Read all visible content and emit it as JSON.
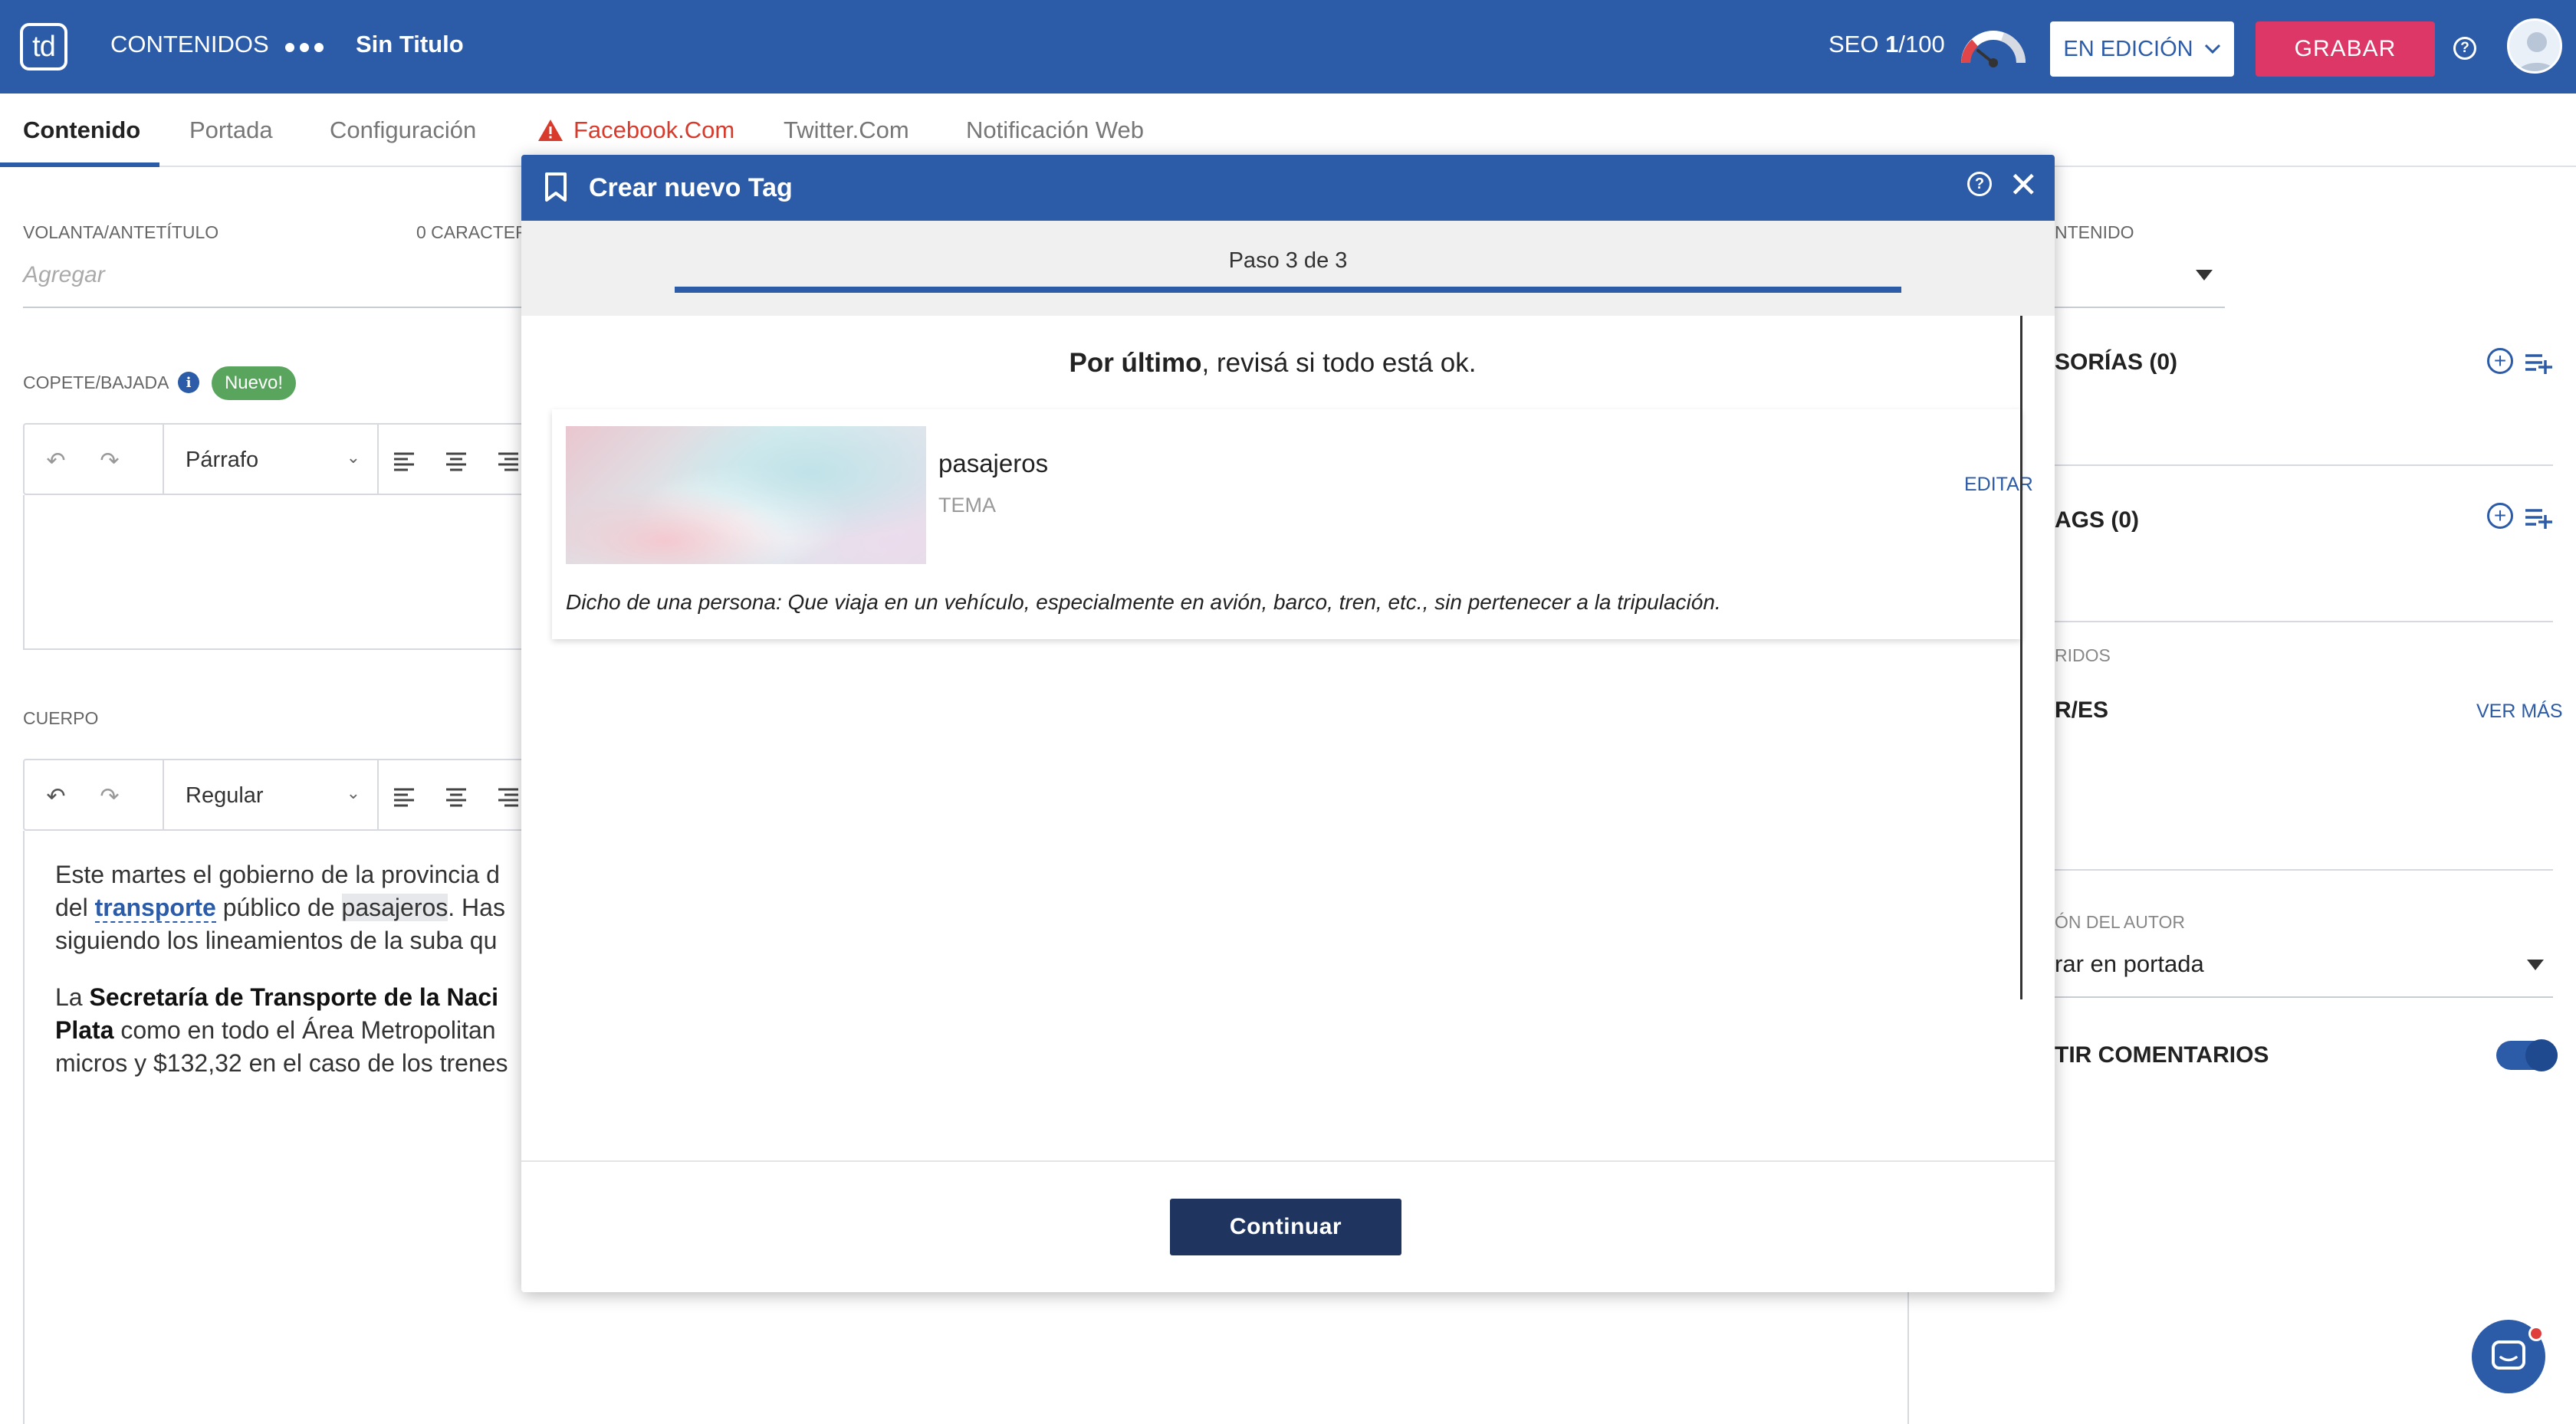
{
  "topbar": {
    "logo": "td",
    "section": "CONTENIDOS",
    "doc_title": "Sin Titulo",
    "seo_label": "SEO ",
    "seo_score": "1",
    "seo_max": "/100",
    "status_label": "EN EDICIÓN",
    "save_label": "GRABAR",
    "help": "?"
  },
  "tabs": [
    {
      "label": "Contenido"
    },
    {
      "label": "Portada"
    },
    {
      "label": "Configuración"
    },
    {
      "label": "Facebook.Com"
    },
    {
      "label": "Twitter.Com"
    },
    {
      "label": "Notificación Web"
    }
  ],
  "editor": {
    "volanta_label": "VOLANTA/ANTETÍTULO",
    "volanta_count": "0 CARACTER",
    "volanta_placeholder": "Agregar",
    "copete_label": "COPETE/BAJADA",
    "copete_badge": "Nuevo!",
    "copete_style": "Párrafo",
    "cuerpo_label": "CUERPO",
    "cuerpo_style": "Regular",
    "body": {
      "p1_l1": "Este martes el gobierno de la provincia d",
      "p1_l2_a": "del ",
      "p1_l2_link": "transporte",
      "p1_l2_b": " público de ",
      "p1_l2_hl": "pasajeros",
      "p1_l2_c": ". Has",
      "p1_l3": "siguiendo los lineamientos de la suba qu",
      "p2_l1_a": "La ",
      "p2_l1_b": "Secretaría de Transporte de la Naci",
      "p2_l2_a": "Plata",
      "p2_l2_b": " como en todo el Área Metropolitan",
      "p2_l3": "micros y $132,32 en el caso de los trenes"
    }
  },
  "right_panel": {
    "contenido_label": "NTENIDO",
    "categorias": "SORÍAS (0)",
    "tags": "AGS (0)",
    "sugeridos": "RIDOS",
    "autores": "R/ES",
    "ver_mas": "VER MÁS",
    "autor_label": "ÓN DEL AUTOR",
    "autor_value": "rar en portada",
    "comentarios": "TIR COMENTARIOS"
  },
  "modal": {
    "title": "Crear nuevo Tag",
    "help": "?",
    "close": "✕",
    "step": "Paso 3 de 3",
    "heading_bold": "Por último",
    "heading_rest": ", revisá si todo está ok.",
    "tag_name": "pasajeros",
    "tag_type": "TEMA",
    "edit_label": "EDITAR",
    "description": "Dicho de una persona: Que viaja en un vehículo, especialmente en avión, barco, tren, etc., sin pertenecer a la tripulación.",
    "continue_label": "Continuar"
  },
  "colors": {
    "brand_blue": "#2c5ba8",
    "save_pink": "#dc3767",
    "new_green": "#5aa55e",
    "warning_red": "#d83a2c",
    "continue_navy": "#1f3560"
  }
}
